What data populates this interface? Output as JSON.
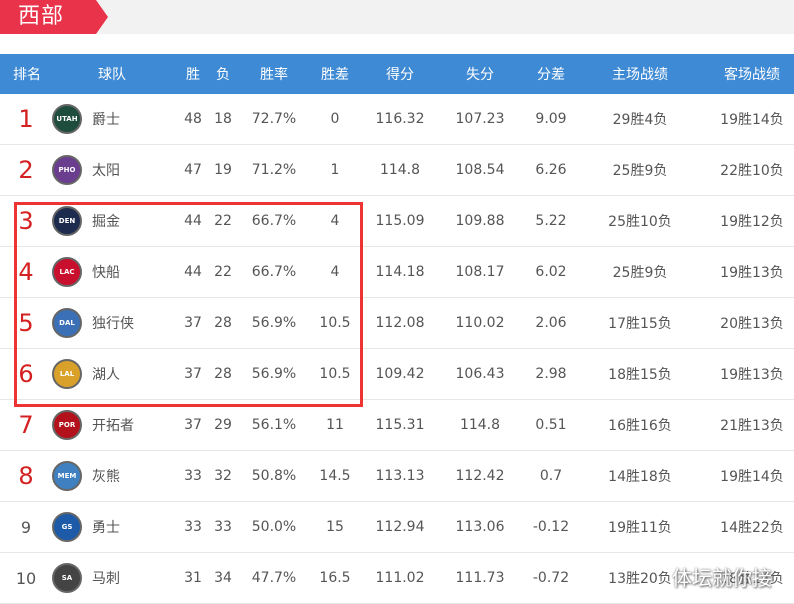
{
  "conference": {
    "label": "西部"
  },
  "header": {
    "rank": "排名",
    "team": "球队",
    "wins": "胜",
    "losses": "负",
    "pct": "胜率",
    "gb": "胜差",
    "pf": "得分",
    "pa": "失分",
    "diff": "分差",
    "home": "主场战绩",
    "away": "客场战绩"
  },
  "rows": [
    {
      "rank": "1",
      "abbr": "UTAH",
      "team": "爵士",
      "w": "48",
      "l": "18",
      "pct": "72.7%",
      "gb": "0",
      "pf": "116.32",
      "pa": "107.23",
      "diff": "9.09",
      "home": "29胜4负",
      "away": "19胜14负"
    },
    {
      "rank": "2",
      "abbr": "PHO",
      "team": "太阳",
      "w": "47",
      "l": "19",
      "pct": "71.2%",
      "gb": "1",
      "pf": "114.8",
      "pa": "108.54",
      "diff": "6.26",
      "home": "25胜9负",
      "away": "22胜10负"
    },
    {
      "rank": "3",
      "abbr": "DEN",
      "team": "掘金",
      "w": "44",
      "l": "22",
      "pct": "66.7%",
      "gb": "4",
      "pf": "115.09",
      "pa": "109.88",
      "diff": "5.22",
      "home": "25胜10负",
      "away": "19胜12负"
    },
    {
      "rank": "4",
      "abbr": "LAC",
      "team": "快船",
      "w": "44",
      "l": "22",
      "pct": "66.7%",
      "gb": "4",
      "pf": "114.18",
      "pa": "108.17",
      "diff": "6.02",
      "home": "25胜9负",
      "away": "19胜13负"
    },
    {
      "rank": "5",
      "abbr": "DAL",
      "team": "独行侠",
      "w": "37",
      "l": "28",
      "pct": "56.9%",
      "gb": "10.5",
      "pf": "112.08",
      "pa": "110.02",
      "diff": "2.06",
      "home": "17胜15负",
      "away": "20胜13负"
    },
    {
      "rank": "6",
      "abbr": "LAL",
      "team": "湖人",
      "w": "37",
      "l": "28",
      "pct": "56.9%",
      "gb": "10.5",
      "pf": "109.42",
      "pa": "106.43",
      "diff": "2.98",
      "home": "18胜15负",
      "away": "19胜13负"
    },
    {
      "rank": "7",
      "abbr": "POR",
      "team": "开拓者",
      "w": "37",
      "l": "29",
      "pct": "56.1%",
      "gb": "11",
      "pf": "115.31",
      "pa": "114.8",
      "diff": "0.51",
      "home": "16胜16负",
      "away": "21胜13负"
    },
    {
      "rank": "8",
      "abbr": "MEM",
      "team": "灰熊",
      "w": "33",
      "l": "32",
      "pct": "50.8%",
      "gb": "14.5",
      "pf": "113.13",
      "pa": "112.42",
      "diff": "0.7",
      "home": "14胜18负",
      "away": "19胜14负"
    },
    {
      "rank": "9",
      "abbr": "GS",
      "team": "勇士",
      "w": "33",
      "l": "33",
      "pct": "50.0%",
      "gb": "15",
      "pf": "112.94",
      "pa": "113.06",
      "diff": "-0.12",
      "home": "19胜11负",
      "away": "14胜22负"
    },
    {
      "rank": "10",
      "abbr": "SA",
      "team": "马刺",
      "w": "31",
      "l": "34",
      "pct": "47.7%",
      "gb": "16.5",
      "pf": "111.02",
      "pa": "111.73",
      "diff": "-0.72",
      "home": "13胜20负",
      "away": "18胜14负"
    }
  ],
  "watermark": "体坛就你接",
  "colors": {
    "accent_red": "#e8334a",
    "header_blue": "#3f8ad4",
    "rank_red": "#d42020",
    "highlight_red": "#ee3333"
  },
  "logo_colors": {
    "UTAH": "#1f4d3d",
    "PHO": "#6a3d8f",
    "DEN": "#1d2b4f",
    "LAC": "#c8102e",
    "DAL": "#3b6fb6",
    "LAL": "#d9a12a",
    "POR": "#b3121c",
    "MEM": "#3e80c0",
    "GS": "#1d5ba8",
    "SA": "#444444"
  }
}
